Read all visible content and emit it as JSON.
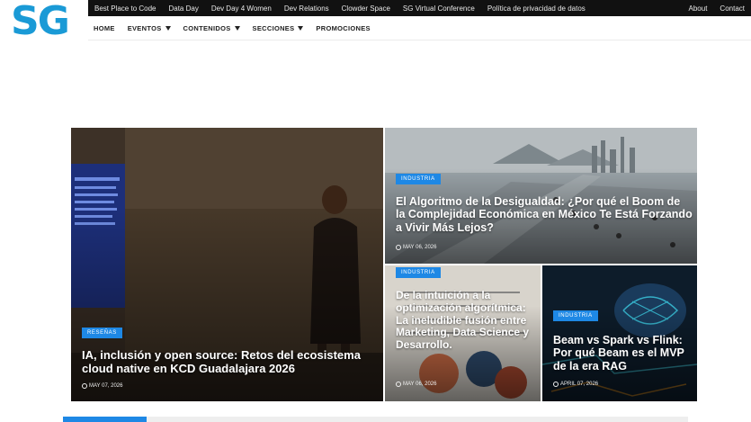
{
  "brand": {
    "logo_text": "SG",
    "color": "#1a9ad6"
  },
  "topbar": {
    "left_links": [
      "Best Place to Code",
      "Data Day",
      "Dev Day 4 Women",
      "Dev Relations",
      "Clowder Space",
      "SG Virtual Conference",
      "Política de privacidad de datos"
    ],
    "right_links": [
      "About",
      "Contact"
    ]
  },
  "mainnav": {
    "home": "HOME",
    "eventos": "EVENTOS",
    "contenidos": "CONTENIDOS",
    "secciones": "SECCIONES",
    "promociones": "PROMOCIONES"
  },
  "featured": [
    {
      "badge": "RESEÑAS",
      "title": "IA, inclusión y open source: Retos del ecosistema cloud native en KCD Guadalajara 2026",
      "date": "MAY 07, 2026"
    },
    {
      "badge": "INDUSTRIA",
      "title": "El Algoritmo de la Desigualdad: ¿Por qué el Boom de la Complejidad Económica en México Te Está Forzando a Vivir Más Lejos?",
      "date": "MAY 06, 2026"
    },
    {
      "badge": "INDUSTRIA",
      "title": "De la intuición a la optimización algorítmica: La ineludible fusión entre Marketing, Data Science y Desarrollo.",
      "date": "MAY 06, 2026"
    },
    {
      "badge": "INDUSTRIA",
      "title": "Beam vs Spark vs Flink: Por qué Beam es el MVP de la era RAG",
      "date": "APRIL 07, 2026"
    }
  ],
  "accent": "#1e88e5"
}
